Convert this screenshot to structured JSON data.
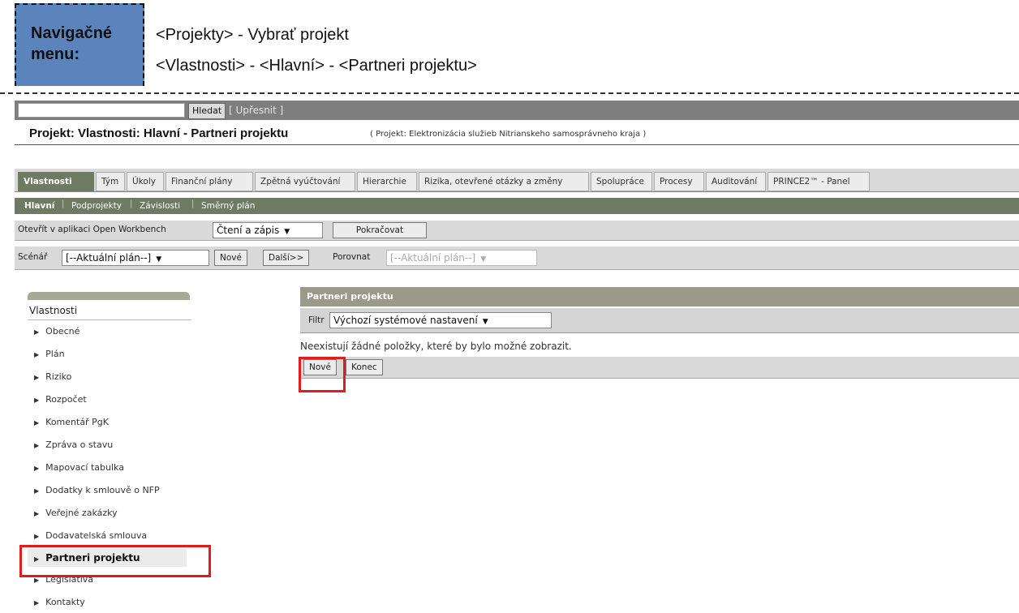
{
  "nav": {
    "label_line1": "Navigačné",
    "label_line2": "menu:",
    "path1": "<Projekty> - Vybrať projekt",
    "path2": "<Vlastnosti> - <Hlavní> - <Partneri projektu>"
  },
  "search": {
    "button": "Hledat",
    "refine": "[ Upřesnit ]"
  },
  "page": {
    "title": "Projekt: Vlastnosti: Hlavní - Partneri projektu",
    "project_sub": "( Projekt: Elektronizácia služieb Nitrianskeho samosprávneho kraja )"
  },
  "tabs": [
    {
      "label": "Vlastnosti",
      "active": true
    },
    {
      "label": "Tým"
    },
    {
      "label": "Úkoly"
    },
    {
      "label": "Finanční plány"
    },
    {
      "label": "Zpětná vyúčtování"
    },
    {
      "label": "Hierarchie"
    },
    {
      "label": "Rizika, otevřené otázky a změny"
    },
    {
      "label": "Spolupráce"
    },
    {
      "label": "Procesy"
    },
    {
      "label": "Auditování"
    },
    {
      "label": "PRINCE2™ - Panel"
    }
  ],
  "subtabs": [
    {
      "label": "Hlavní",
      "active": true
    },
    {
      "label": "Podprojekty"
    },
    {
      "label": "Závislosti"
    },
    {
      "label": "Směrný plán"
    }
  ],
  "owb": {
    "label": "Otevřít v aplikaci Open Workbench",
    "mode": "Čtení a zápis",
    "continue": "Pokračovat"
  },
  "scenario": {
    "label": "Scénář",
    "current": "[--Aktuální plán--]",
    "new": "Nové",
    "next": "Další>>",
    "compare_label": "Porovnat",
    "compare_value": "[--Aktuální plán--]"
  },
  "left_menu": {
    "header": "Vlastnosti",
    "items": [
      "Obecné",
      "Plán",
      "Riziko",
      "Rozpočet",
      "Komentář PgK",
      "Zpráva o stavu",
      "Mapovací tabulka",
      "Dodatky k smlouvě o NFP",
      "Veřejné zakázky",
      "Dodavatelská smlouva",
      "Partneri projektu",
      "Legislatíva",
      "Kontakty"
    ],
    "active_index": 10
  },
  "panel": {
    "title": "Partneri projektu",
    "filter_label": "Filtr",
    "filter_value": "Výchozí systémové nastavení",
    "empty_text": "Neexistují žádné položky, které by bylo možné zobrazit.",
    "new_button": "Nové",
    "end_button": "Konec"
  }
}
